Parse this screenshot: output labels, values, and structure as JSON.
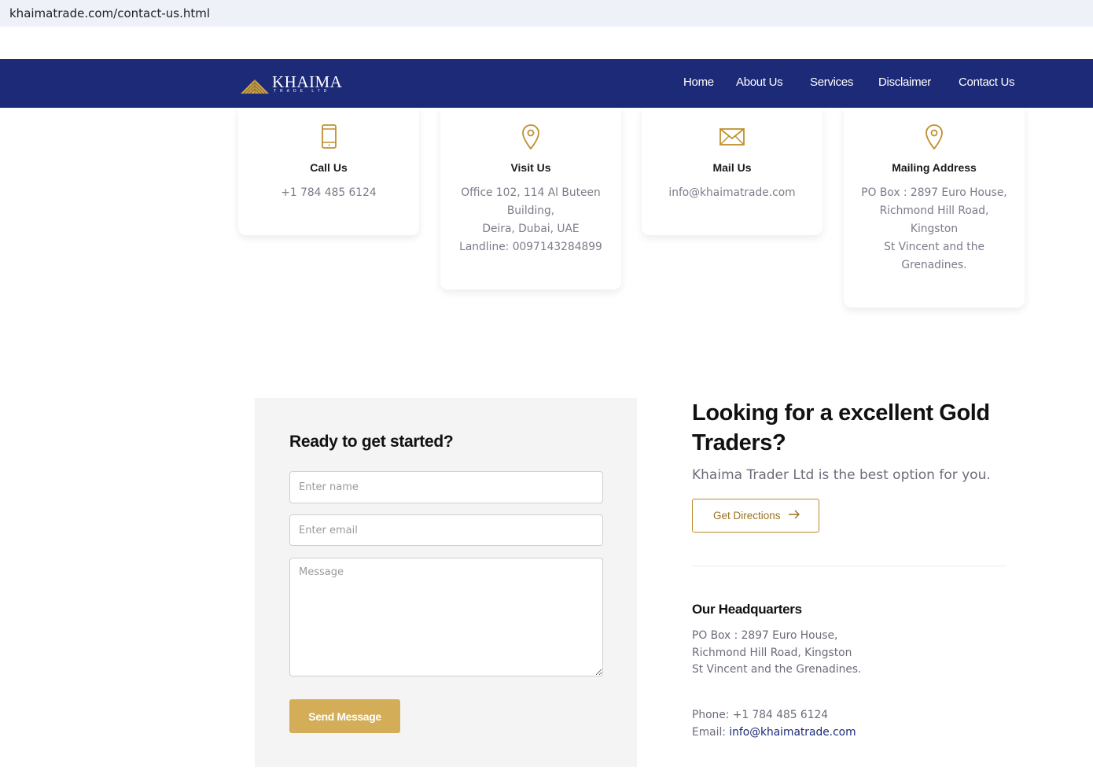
{
  "browser": {
    "url": "khaimatrade.com/contact-us.html"
  },
  "logo": {
    "brand": "KHAIMA",
    "sub": "TRADE LTD"
  },
  "nav": {
    "items": [
      "Home",
      "About Us",
      "Services",
      "Disclaimer",
      "Contact Us"
    ]
  },
  "cards": [
    {
      "icon": "phone-icon",
      "title": "Call Us",
      "lines": [
        "+1 784 485 6124"
      ]
    },
    {
      "icon": "location-pin-icon",
      "title": "Visit Us",
      "lines": [
        "Office 102, 114 Al Buteen",
        "Building,",
        "Deira, Dubai, UAE",
        "Landline: 0097143284899"
      ]
    },
    {
      "icon": "envelope-icon",
      "title": "Mail Us",
      "lines": [
        "info@khaimatrade.com"
      ]
    },
    {
      "icon": "location-pin-icon",
      "title": "Mailing Address",
      "lines": [
        "PO Box : 2897 Euro House,",
        "Richmond Hill Road,",
        "Kingston",
        "St Vincent and the",
        "Grenadines."
      ]
    }
  ],
  "form": {
    "title": "Ready to get started?",
    "name_placeholder": "Enter name",
    "email_placeholder": "Enter email",
    "message_placeholder": "Message",
    "submit_label": "Send Message"
  },
  "promo": {
    "title": "Looking for a excellent Gold Traders?",
    "lead": "Khaima Trader Ltd is the best option for you.",
    "directions_label": "Get Directions"
  },
  "headquarters": {
    "title": "Our Headquarters",
    "address": [
      "PO Box : 2897 Euro House,",
      "Richmond Hill Road, Kingston",
      "St Vincent and the Grenadines."
    ],
    "phone": "Phone: +1 784 485 6124",
    "email_label": "Email: ",
    "email": "info@khaimatrade.com"
  },
  "colors": {
    "nav_bg": "#1c2a78",
    "gold": "#d3ad57",
    "gold_dark": "#b98a2c",
    "text_muted": "#7b7b8a"
  }
}
